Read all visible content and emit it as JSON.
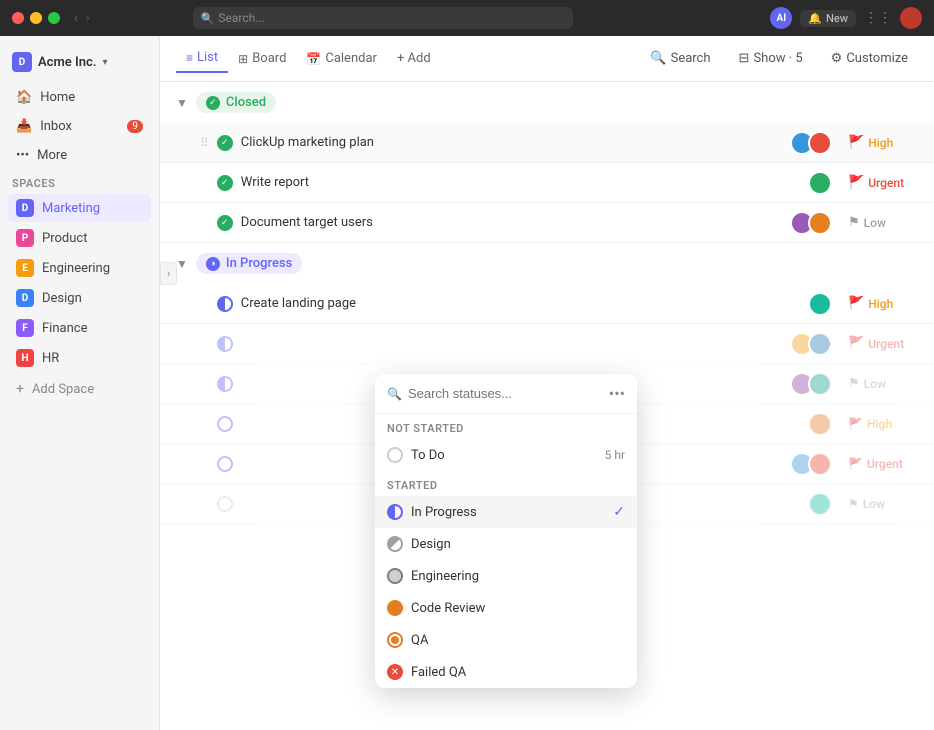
{
  "titlebar": {
    "search_placeholder": "Search...",
    "ai_label": "AI",
    "new_label": "New"
  },
  "sidebar": {
    "workspace": "Acme Inc.",
    "nav": [
      {
        "id": "home",
        "label": "Home",
        "icon": "🏠"
      },
      {
        "id": "inbox",
        "label": "Inbox",
        "icon": "📥",
        "badge": "9"
      },
      {
        "id": "more",
        "label": "More",
        "icon": "•••"
      }
    ],
    "spaces_label": "Spaces",
    "spaces": [
      {
        "id": "marketing",
        "label": "Marketing",
        "letter": "D",
        "color": "dot-marketing",
        "active": true
      },
      {
        "id": "product",
        "label": "Product",
        "letter": "P",
        "color": "dot-product",
        "active": false
      },
      {
        "id": "engineering",
        "label": "Engineering",
        "letter": "E",
        "color": "dot-engineering",
        "active": false
      },
      {
        "id": "design",
        "label": "Design",
        "letter": "D",
        "color": "dot-design",
        "active": false
      },
      {
        "id": "finance",
        "label": "Finance",
        "letter": "F",
        "color": "dot-finance",
        "active": false
      },
      {
        "id": "hr",
        "label": "HR",
        "letter": "H",
        "color": "dot-hr",
        "active": false
      }
    ],
    "add_space_label": "Add Space"
  },
  "toolbar": {
    "tabs": [
      {
        "id": "list",
        "label": "List",
        "icon": "≡",
        "active": true
      },
      {
        "id": "board",
        "label": "Board",
        "icon": "⊞",
        "active": false
      },
      {
        "id": "calendar",
        "label": "Calendar",
        "icon": "📅",
        "active": false
      }
    ],
    "add_label": "+ Add",
    "search_label": "Search",
    "show_label": "Show · 5",
    "customize_label": "Customize"
  },
  "sections": [
    {
      "id": "closed",
      "label": "Closed",
      "status": "closed",
      "expanded": true,
      "tasks": [
        {
          "id": 1,
          "name": "ClickUp marketing plan",
          "checked": true,
          "avatars": [
            "av1",
            "av2"
          ],
          "priority": "High",
          "priority_class": "flag-high"
        },
        {
          "id": 2,
          "name": "Write report",
          "checked": true,
          "avatars": [
            "av3"
          ],
          "priority": "Urgent",
          "priority_class": "flag-urgent"
        },
        {
          "id": 3,
          "name": "Document target users",
          "checked": true,
          "avatars": [
            "av4",
            "av5"
          ],
          "priority": "Low",
          "priority_class": "flag-low"
        }
      ]
    },
    {
      "id": "in-progress",
      "label": "In Progress",
      "status": "in-progress",
      "expanded": true,
      "tasks": [
        {
          "id": 4,
          "name": "Create landing page",
          "checked": false,
          "half": true,
          "avatars": [
            "av6"
          ],
          "priority": "High",
          "priority_class": "flag-high"
        },
        {
          "id": 5,
          "name": "",
          "checked": false,
          "half": true,
          "avatars": [
            "av7",
            "av8"
          ],
          "priority": "Urgent",
          "priority_class": "flag-urgent"
        },
        {
          "id": 6,
          "name": "",
          "checked": false,
          "half": true,
          "avatars": [
            "av9",
            "av10"
          ],
          "priority": "Low",
          "priority_class": "flag-low"
        }
      ]
    },
    {
      "id": "section3",
      "tasks": [
        {
          "id": 7,
          "name": "",
          "avatars": [
            "av5"
          ],
          "priority": "High",
          "priority_class": "flag-high"
        },
        {
          "id": 8,
          "name": "",
          "avatars": [
            "av1",
            "av2"
          ],
          "priority": "Urgent",
          "priority_class": "flag-urgent"
        },
        {
          "id": 9,
          "name": "",
          "avatars": [
            "av6"
          ],
          "priority": "Low",
          "priority_class": "flag-low"
        }
      ]
    }
  ],
  "dropdown": {
    "search_placeholder": "Search statuses...",
    "sections": [
      {
        "title": "NOT STARTED",
        "items": [
          {
            "id": "todo",
            "label": "To Do",
            "time": "5 hr",
            "type": "circle"
          }
        ]
      },
      {
        "title": "STARTED",
        "items": [
          {
            "id": "in-progress",
            "label": "In Progress",
            "active": true,
            "type": "half"
          },
          {
            "id": "design",
            "label": "Design",
            "type": "design"
          },
          {
            "id": "engineering",
            "label": "Engineering",
            "type": "eng"
          },
          {
            "id": "code-review",
            "label": "Code Review",
            "type": "code"
          },
          {
            "id": "qa",
            "label": "QA",
            "type": "qa"
          },
          {
            "id": "failed-qa",
            "label": "Failed QA",
            "type": "failed"
          }
        ]
      }
    ]
  }
}
